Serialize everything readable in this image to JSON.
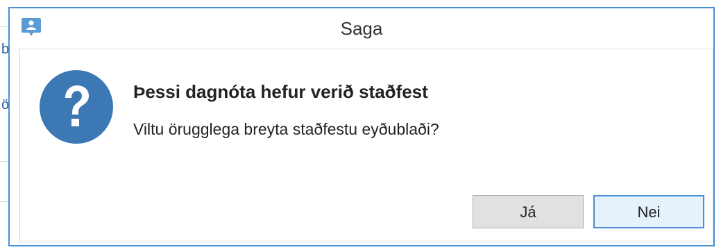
{
  "window": {
    "title": "Saga",
    "app_icon": "person-badge-icon"
  },
  "dialog": {
    "icon": "question-icon",
    "heading": "Þessi dagnóta hefur verið staðfest",
    "message": "Viltu örugglega breyta staðfestu eyðublaði?"
  },
  "buttons": {
    "yes_label": "Já",
    "no_label": "Nei"
  },
  "background": {
    "edge_chars": [
      "b",
      "ö"
    ]
  },
  "colors": {
    "accent": "#4a8fd4",
    "icon_blue": "#3c78b4",
    "app_icon_blue": "#5b9bd5"
  }
}
